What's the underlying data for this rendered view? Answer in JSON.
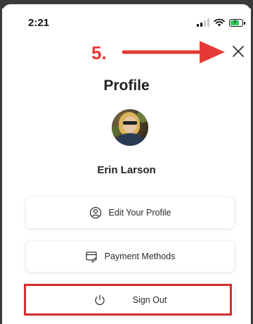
{
  "status_bar": {
    "time": "2:21"
  },
  "annotation": {
    "step_label": "5.",
    "color": "#e53935",
    "highlight_color": "#d32f2f"
  },
  "header": {
    "title": "Profile"
  },
  "user": {
    "name": "Erin Larson"
  },
  "menu": {
    "items": [
      {
        "label": "Edit Your Profile",
        "icon": "user-circle-icon"
      },
      {
        "label": "Payment Methods",
        "icon": "payment-card-icon"
      },
      {
        "label": "Sign Out",
        "icon": "power-icon"
      }
    ]
  },
  "icons": {
    "close": "close-icon"
  },
  "colors": {
    "battery": "#34c759",
    "background": "#ffffff"
  }
}
